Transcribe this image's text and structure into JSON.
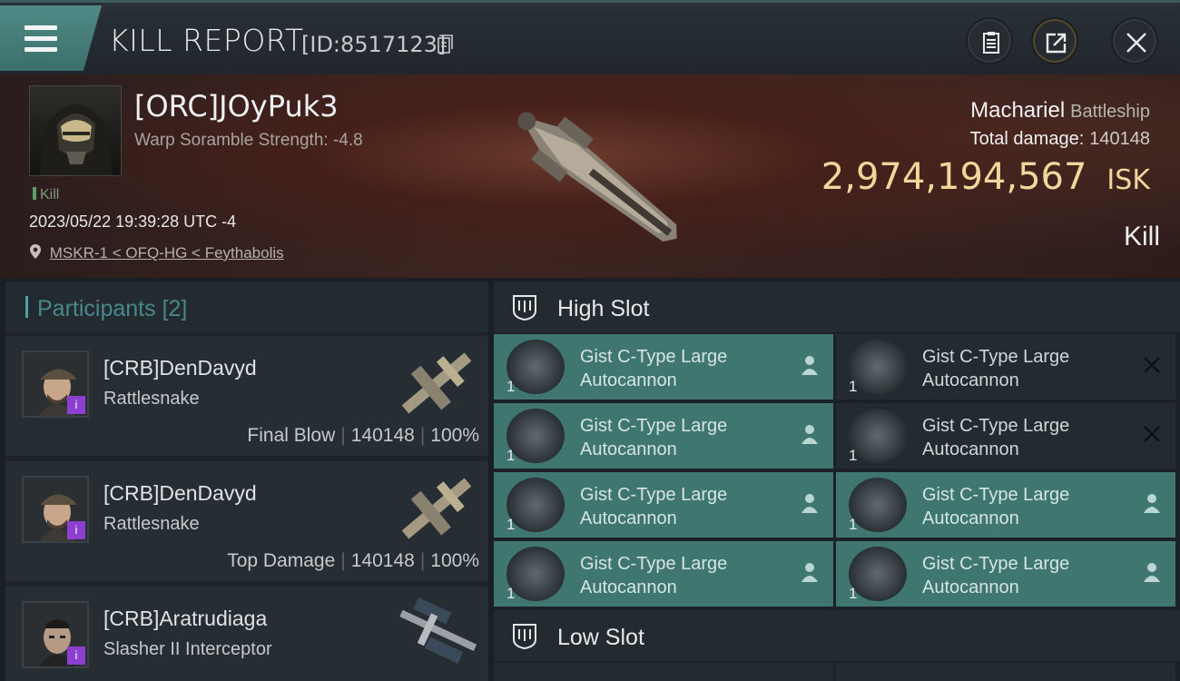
{
  "header": {
    "title": "KILL REPORT",
    "report_id": "[ID:8517123]"
  },
  "victim": {
    "name": "[ORC]JOyPuk3",
    "warp_scramble": "Warp Soramble Strength: -4.8",
    "tag": "Kill",
    "datetime": "2023/05/22 19:39:28 UTC -4",
    "location": "MSKR-1 < OFQ-HG < Feythabolis",
    "ship_name": "Machariel",
    "ship_class": "Battleship",
    "total_damage_label": "Total damage:",
    "total_damage": "140148",
    "isk_value": "2,974,194,567",
    "isk_unit": "ISK",
    "result": "Kill"
  },
  "participants": {
    "title": "Participants",
    "count": "[2]",
    "rows": [
      {
        "name": "[CRB]DenDavyd",
        "ship": "Rattlesnake",
        "role": "Final Blow",
        "damage": "140148",
        "percent": "100%"
      },
      {
        "name": "[CRB]DenDavyd",
        "ship": "Rattlesnake",
        "role": "Top Damage",
        "damage": "140148",
        "percent": "100%"
      },
      {
        "name": "[CRB]Aratrudiaga",
        "ship": "Slasher II Interceptor"
      }
    ]
  },
  "fitting": {
    "high_slot_title": "High Slot",
    "low_slot_title": "Low Slot",
    "modules": [
      {
        "name": "Gist C-Type Large Autocannon",
        "qty": "1",
        "state": "fitted"
      },
      {
        "name": "Gist C-Type Large Autocannon",
        "qty": "1",
        "state": "destroyed"
      },
      {
        "name": "Gist C-Type Large Autocannon",
        "qty": "1",
        "state": "fitted"
      },
      {
        "name": "Gist C-Type Large Autocannon",
        "qty": "1",
        "state": "destroyed"
      },
      {
        "name": "Gist C-Type Large Autocannon",
        "qty": "1",
        "state": "fitted"
      },
      {
        "name": "Gist C-Type Large Autocannon",
        "qty": "1",
        "state": "fitted"
      },
      {
        "name": "Gist C-Type Large Autocannon",
        "qty": "1",
        "state": "fitted"
      },
      {
        "name": "Gist C-Type Large Autocannon",
        "qty": "1",
        "state": "fitted"
      }
    ]
  },
  "colors": {
    "accent_teal": "#3f7670",
    "isk_gold": "#f2d79c",
    "corp_badge": "#8c3fd1"
  },
  "icons": [
    "menu-icon",
    "copy-icon",
    "clipboard-icon",
    "share-icon",
    "close-icon",
    "location-pin-icon",
    "slot-icon",
    "pilot-icon",
    "destroyed-x-icon"
  ]
}
